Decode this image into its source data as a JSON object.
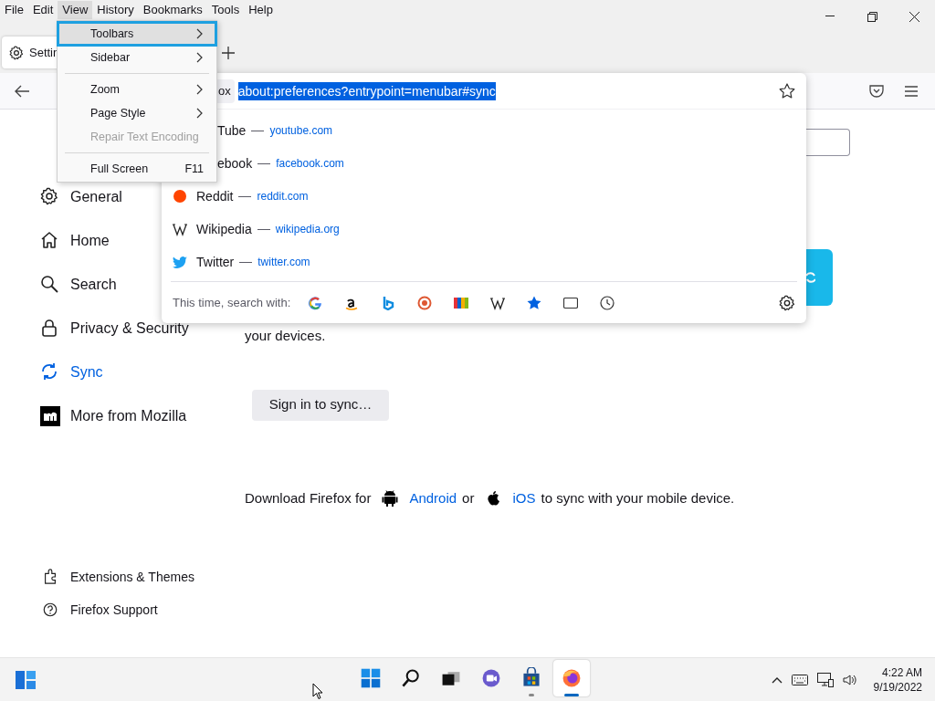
{
  "menubar": [
    {
      "label": "File",
      "selected": false
    },
    {
      "label": "Edit",
      "selected": false
    },
    {
      "label": "View",
      "selected": true
    },
    {
      "label": "History",
      "selected": false
    },
    {
      "label": "Bookmarks",
      "selected": false
    },
    {
      "label": "Tools",
      "selected": false
    },
    {
      "label": "Help",
      "selected": false
    }
  ],
  "tabs": [
    {
      "label": "Settin",
      "selected": true
    }
  ],
  "urlbar": {
    "identity": "ox",
    "url": "about:preferences?entrypoint=menubar#sync"
  },
  "view_menu": [
    {
      "kind": "submenu",
      "label": "Toolbars",
      "selected": true,
      "disabled": false
    },
    {
      "kind": "submenu",
      "label": "Sidebar",
      "selected": false,
      "disabled": false
    },
    {
      "kind": "separator"
    },
    {
      "kind": "submenu",
      "label": "Zoom",
      "selected": false,
      "disabled": false
    },
    {
      "kind": "submenu",
      "label": "Page Style",
      "selected": false,
      "disabled": false
    },
    {
      "kind": "item",
      "label": "Repair Text Encoding",
      "selected": false,
      "disabled": true
    },
    {
      "kind": "separator"
    },
    {
      "kind": "item",
      "label": "Full Screen",
      "shortcut": "F11",
      "selected": false,
      "disabled": false
    }
  ],
  "suggestions": [
    {
      "kind": "partial",
      "name": "Tube",
      "url": "youtube.com"
    },
    {
      "kind": "partial",
      "name": "ebook",
      "url": "facebook.com"
    },
    {
      "kind": "reddit",
      "name": "Reddit",
      "url": "reddit.com"
    },
    {
      "kind": "wiki",
      "name": "Wikipedia",
      "url": "wikipedia.org"
    },
    {
      "kind": "twitter",
      "name": "Twitter",
      "url": "twitter.com"
    }
  ],
  "search_with_label": "This time, search with:",
  "sidebar": {
    "items": [
      {
        "label": "General",
        "selected": false
      },
      {
        "label": "Home",
        "selected": false
      },
      {
        "label": "Search",
        "selected": false
      },
      {
        "label": "Privacy & Security",
        "selected": false
      },
      {
        "label": "Sync",
        "selected": true
      },
      {
        "label": "More from Mozilla",
        "selected": false
      }
    ],
    "footer": [
      {
        "label": "Extensions & Themes"
      },
      {
        "label": "Firefox Support"
      }
    ]
  },
  "main": {
    "partial_text": "your devices.",
    "sign_in_button": "Sign in to sync…",
    "download_line": [
      {
        "kind": "text",
        "text": "Download Firefox for"
      },
      {
        "kind": "link",
        "text": "Android"
      },
      {
        "kind": "text",
        "text": "or"
      },
      {
        "kind": "link",
        "text": "iOS"
      },
      {
        "kind": "text",
        "text": "to sync with your mobile device."
      }
    ]
  },
  "taskbar": {
    "apps": [
      {
        "selected": false,
        "running": false
      },
      {
        "selected": false,
        "running": false
      },
      {
        "selected": false,
        "running": false
      },
      {
        "selected": false,
        "running": false
      },
      {
        "selected": false,
        "running": true
      },
      {
        "selected": true,
        "running": true
      }
    ],
    "time": "4:22 AM",
    "date": "9/19/2022"
  }
}
